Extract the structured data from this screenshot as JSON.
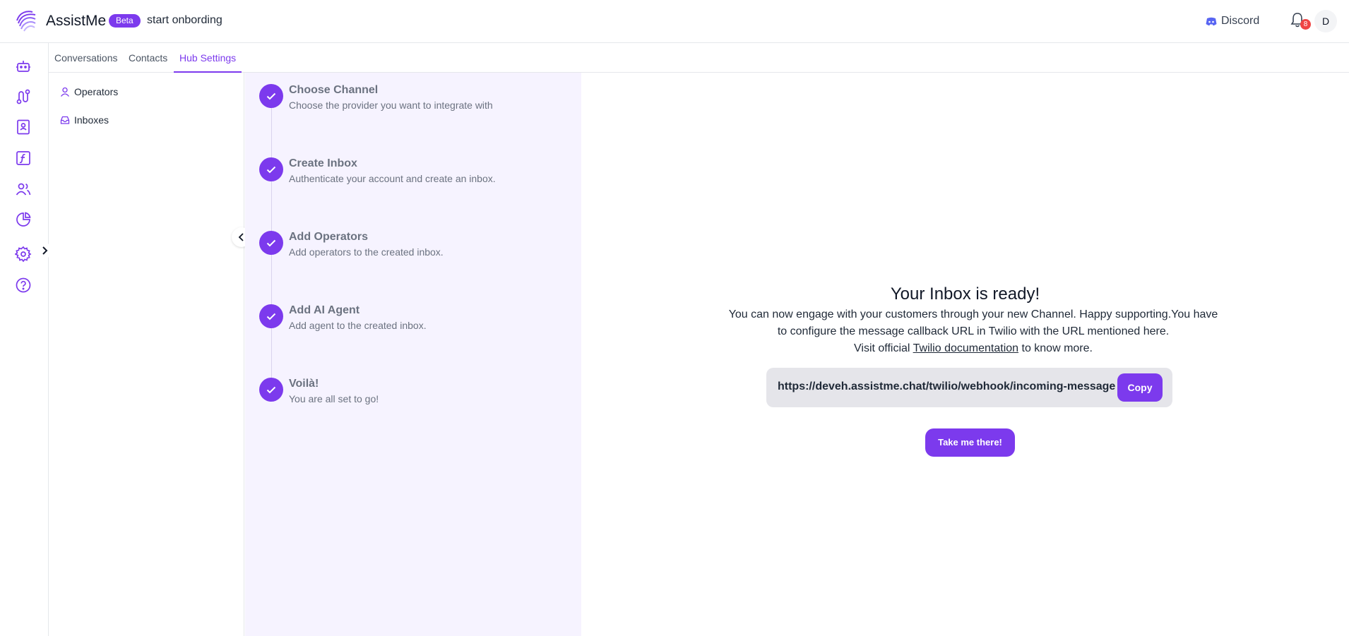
{
  "header": {
    "app_name": "AssistMe",
    "beta_label": "Beta",
    "onboarding_label": "start onbording",
    "discord_label": "Discord",
    "notification_count": "8",
    "avatar_initial": "D"
  },
  "rail": {
    "icons": [
      "bot-icon",
      "flow-icon",
      "contacts-book-icon",
      "function-icon",
      "users-icon",
      "analytics-icon",
      "settings-icon",
      "help-icon"
    ]
  },
  "tabs": [
    {
      "label": "Conversations",
      "active": false
    },
    {
      "label": "Contacts",
      "active": false
    },
    {
      "label": "Hub Settings",
      "active": true
    }
  ],
  "subnav": {
    "items": [
      {
        "label": "Operators",
        "icon": "user-icon"
      },
      {
        "label": "Inboxes",
        "icon": "inbox-icon"
      }
    ]
  },
  "steps": [
    {
      "title": "Choose Channel",
      "desc": "Choose the provider you want to integrate with",
      "done": true
    },
    {
      "title": "Create Inbox",
      "desc": "Authenticate your account and create an inbox.",
      "done": true
    },
    {
      "title": "Add Operators",
      "desc": "Add operators to the created inbox.",
      "done": true
    },
    {
      "title": "Add AI Agent",
      "desc": "Add agent to the created inbox.",
      "done": true
    },
    {
      "title": "Voilà!",
      "desc": "You are all set to go!",
      "done": true
    }
  ],
  "main": {
    "title": "Your Inbox is ready!",
    "text_line1": "You can now engage with your customers through your new Channel. Happy supporting.You have to configure the message callback URL in Twilio with the URL mentioned here.",
    "visit_prefix": "Visit official ",
    "visit_link": "Twilio documentation",
    "visit_suffix": " to know more.",
    "webhook_url": "https://deveh.assistme.chat/twilio/webhook/incoming-message",
    "copy_label": "Copy",
    "take_me_label": "Take me there!"
  },
  "colors": {
    "accent": "#7c3aed",
    "stepper_bg": "#f6f3ff",
    "badge_red": "#ef4444"
  }
}
